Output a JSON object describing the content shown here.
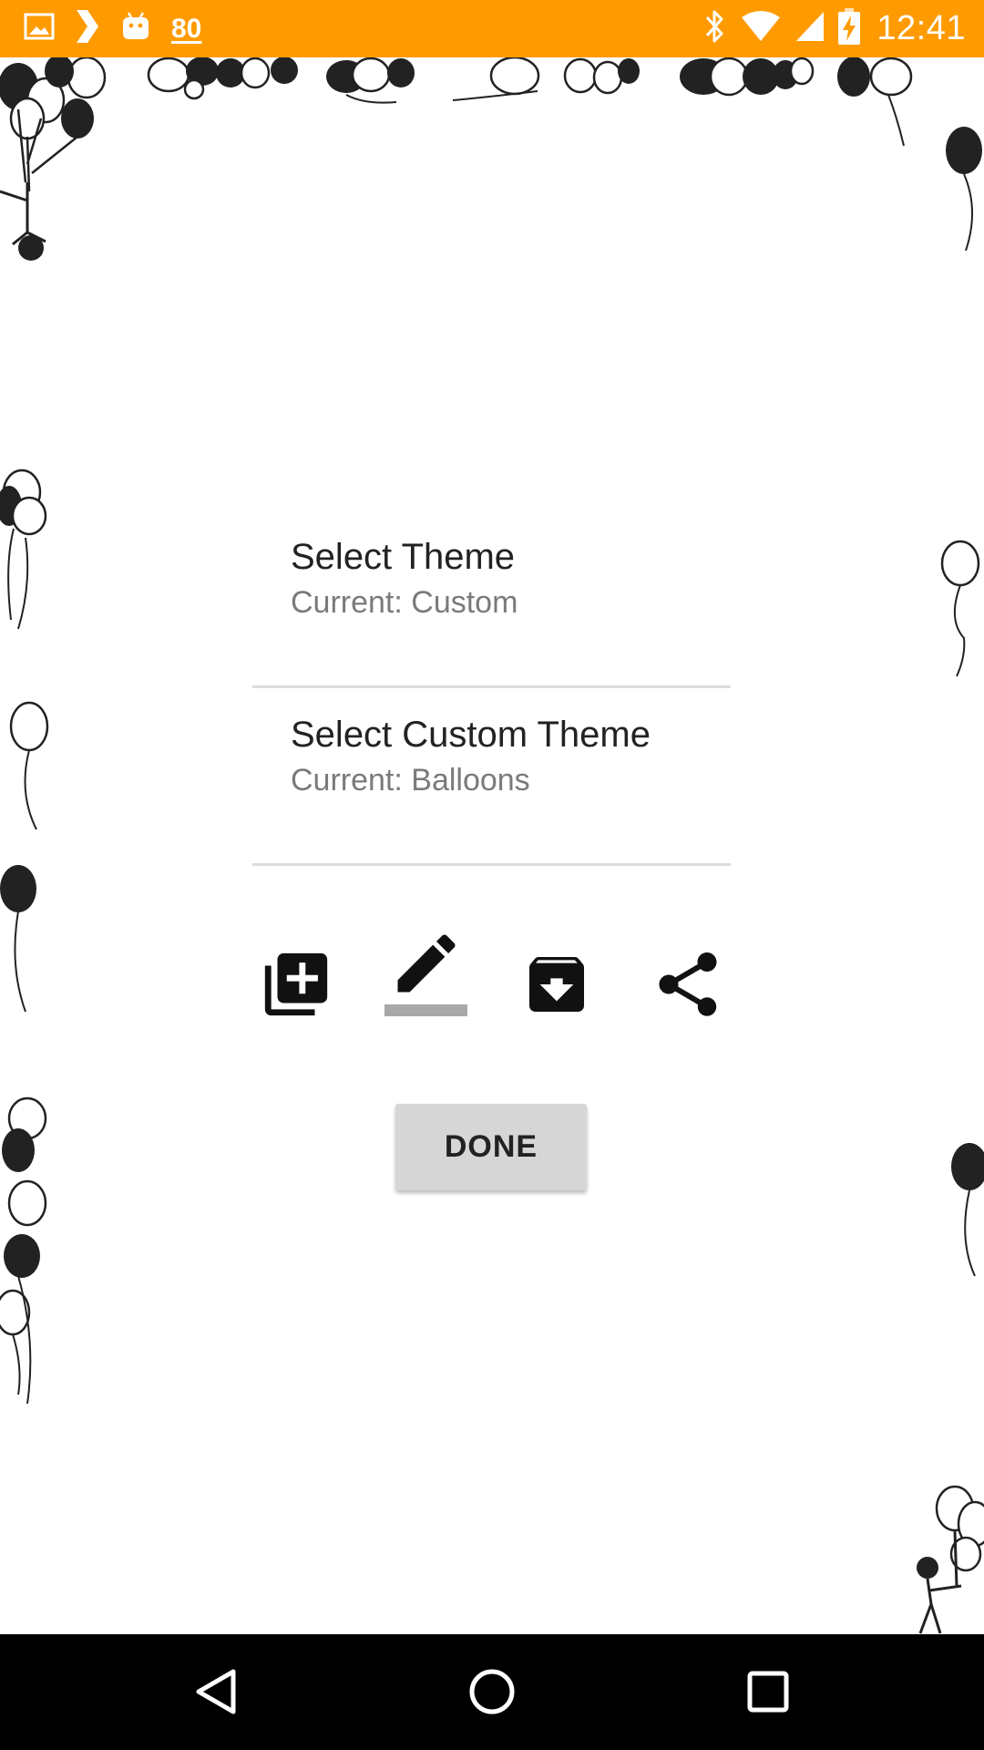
{
  "status_bar": {
    "background": "#ff9b00",
    "notification_count": "80",
    "time": "12:41",
    "icons": [
      "image-icon",
      "chevron-icon",
      "android-icon",
      "bluetooth-icon",
      "wifi-icon",
      "signal-icon",
      "battery-charging-icon"
    ]
  },
  "settings": {
    "items": [
      {
        "title": "Select Theme",
        "subtitle": "Current: Custom"
      },
      {
        "title": "Select Custom Theme",
        "subtitle": "Current: Balloons"
      }
    ]
  },
  "toolbar": {
    "icons": [
      "add-theme-icon",
      "edit-icon",
      "archive-download-icon",
      "share-icon"
    ],
    "selected": "edit-icon"
  },
  "done_button": {
    "label": "DONE"
  },
  "nav_bar": {
    "icons": [
      "back-icon",
      "home-icon",
      "recents-icon"
    ]
  },
  "colors": {
    "accent": "#ff9b00",
    "divider": "#dcdcdc",
    "button_bg": "#d6d6d6"
  }
}
